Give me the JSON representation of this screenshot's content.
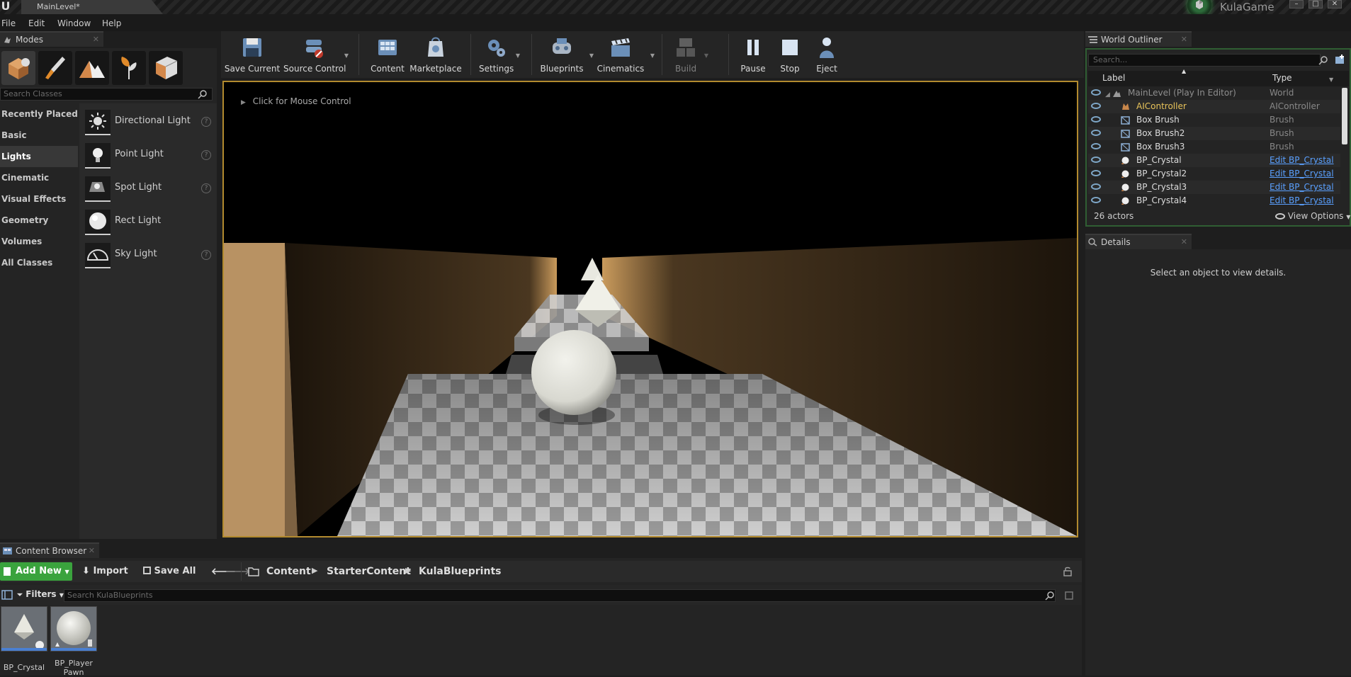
{
  "window": {
    "doc_tab": "MainLevel*",
    "project_name": "KulaGame",
    "controls": [
      "–",
      "□",
      "✕"
    ]
  },
  "menu": [
    "File",
    "Edit",
    "Window",
    "Help"
  ],
  "modes": {
    "tab_title": "Modes",
    "search_placeholder": "Search Classes",
    "categories": [
      "Recently Placed",
      "Basic",
      "Lights",
      "Cinematic",
      "Visual Effects",
      "Geometry",
      "Volumes",
      "All Classes"
    ],
    "active_category": "Lights",
    "items": [
      {
        "label": "Directional Light",
        "icon": "directional-light-icon"
      },
      {
        "label": "Point Light",
        "icon": "point-light-icon"
      },
      {
        "label": "Spot Light",
        "icon": "spot-light-icon"
      },
      {
        "label": "Rect Light",
        "icon": "rect-light-icon"
      },
      {
        "label": "Sky Light",
        "icon": "sky-light-icon"
      }
    ],
    "help_glyph": "?"
  },
  "toolbar": {
    "save_current": "Save Current",
    "source_control": "Source Control",
    "content": "Content",
    "marketplace": "Marketplace",
    "settings": "Settings",
    "blueprints": "Blueprints",
    "cinematics": "Cinematics",
    "build": "Build",
    "pause": "Pause",
    "stop": "Stop",
    "eject": "Eject"
  },
  "viewport": {
    "mouse_hint": "Click for Mouse Control"
  },
  "outliner": {
    "tab_title": "World Outliner",
    "search_placeholder": "Search...",
    "col_label": "Label",
    "col_type": "Type",
    "rows": [
      {
        "label": "MainLevel (Play In Editor)",
        "type": "World",
        "link": false
      },
      {
        "label": "AIController",
        "type": "AIController",
        "link": false
      },
      {
        "label": "Box Brush",
        "type": "Brush",
        "link": false
      },
      {
        "label": "Box Brush2",
        "type": "Brush",
        "link": false
      },
      {
        "label": "Box Brush3",
        "type": "Brush",
        "link": false
      },
      {
        "label": "BP_Crystal",
        "type": "Edit BP_Crystal",
        "link": true
      },
      {
        "label": "BP_Crystal2",
        "type": "Edit BP_Crystal",
        "link": true
      },
      {
        "label": "BP_Crystal3",
        "type": "Edit BP_Crystal",
        "link": true
      },
      {
        "label": "BP_Crystal4",
        "type": "Edit BP_Crystal",
        "link": true
      }
    ],
    "actor_count": "26 actors",
    "view_options": "View Options"
  },
  "details": {
    "tab_title": "Details",
    "empty_message": "Select an object to view details."
  },
  "content_browser": {
    "tab_title": "Content Browser",
    "add_new": "Add New",
    "import": "Import",
    "save_all": "Save All",
    "breadcrumb": [
      "Content",
      "StarterContent",
      "KulaBlueprints"
    ],
    "filters": "Filters",
    "search_placeholder": "Search KulaBlueprints",
    "assets": [
      {
        "name": "BP_Crystal"
      },
      {
        "name": "BP_Player Pawn"
      }
    ]
  },
  "colors": {
    "accent_green": "#3aa33d",
    "viewport_border": "#b28a2e",
    "link_blue": "#5aa0ff",
    "ai_controller_yellow": "#e8c35a"
  }
}
